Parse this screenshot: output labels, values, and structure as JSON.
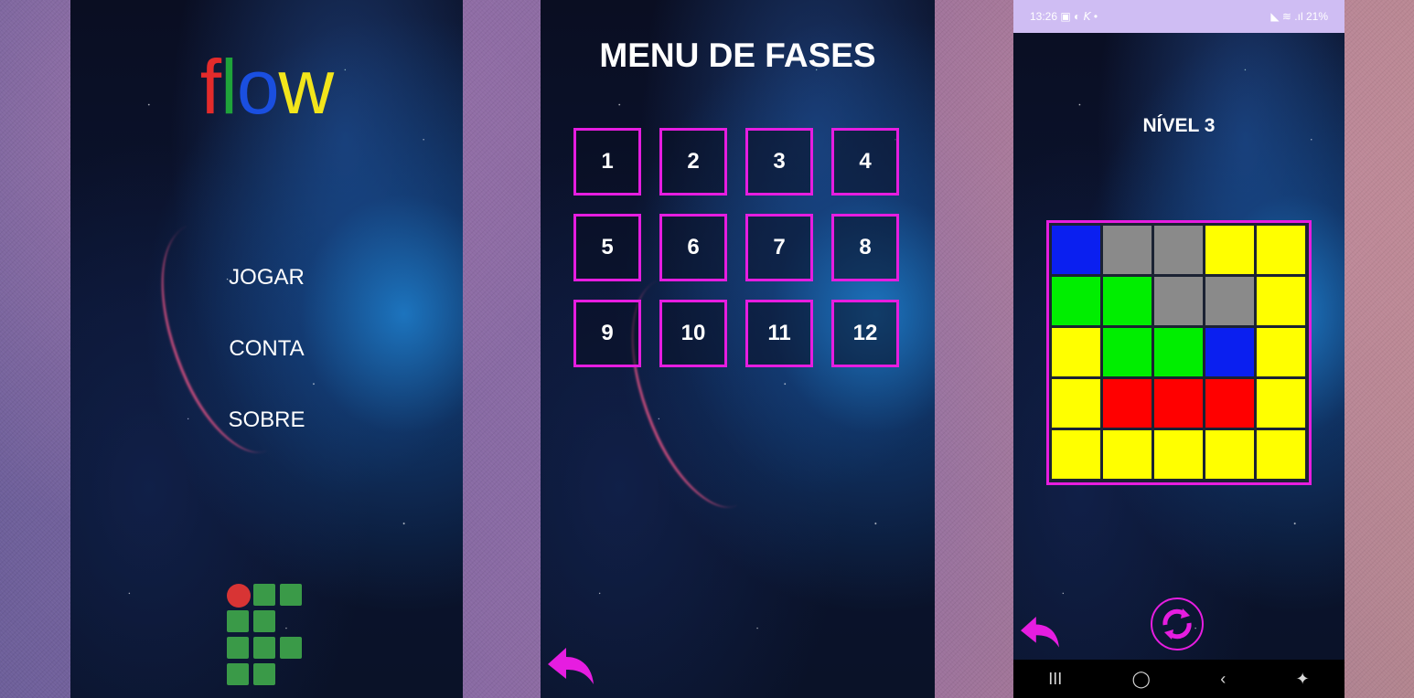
{
  "screen1": {
    "logo_letters": [
      {
        "char": "f",
        "color": "#e32b2b"
      },
      {
        "char": "l",
        "color": "#1fa33a"
      },
      {
        "char": "o",
        "color": "#1a4fe0"
      },
      {
        "char": "w",
        "color": "#f3e51b"
      }
    ],
    "menu": [
      "JOGAR",
      "CONTA",
      "SOBRE"
    ]
  },
  "screen2": {
    "title": "MENU DE FASES",
    "phases": [
      "1",
      "2",
      "3",
      "4",
      "5",
      "6",
      "7",
      "8",
      "9",
      "10",
      "11",
      "12"
    ],
    "back_icon": "back-arrow-icon"
  },
  "screen3": {
    "status_bar": {
      "time": "13:26",
      "left_icons": "▣ ◐ 𝘒 •",
      "right_text": "◣ ≋ .ıl 21%"
    },
    "level_title": "NÍVEL 3",
    "grid": [
      [
        "blue",
        "gray",
        "gray",
        "yellow",
        "yellow"
      ],
      [
        "green",
        "green",
        "gray",
        "gray",
        "yellow"
      ],
      [
        "yellow",
        "green",
        "green",
        "blue",
        "yellow"
      ],
      [
        "yellow",
        "red",
        "red",
        "red",
        "yellow"
      ],
      [
        "yellow",
        "yellow",
        "yellow",
        "yellow",
        "yellow"
      ]
    ],
    "colors": {
      "blue": "#0a1ff0",
      "gray": "#8a8a8a",
      "yellow": "#ffff00",
      "green": "#00ee00",
      "red": "#ff0000",
      "accent": "#e61de0"
    },
    "nav_bar": [
      "III",
      "◯",
      "‹",
      "✦"
    ],
    "reload_icon": "reload-icon",
    "back_icon": "back-arrow-icon"
  }
}
